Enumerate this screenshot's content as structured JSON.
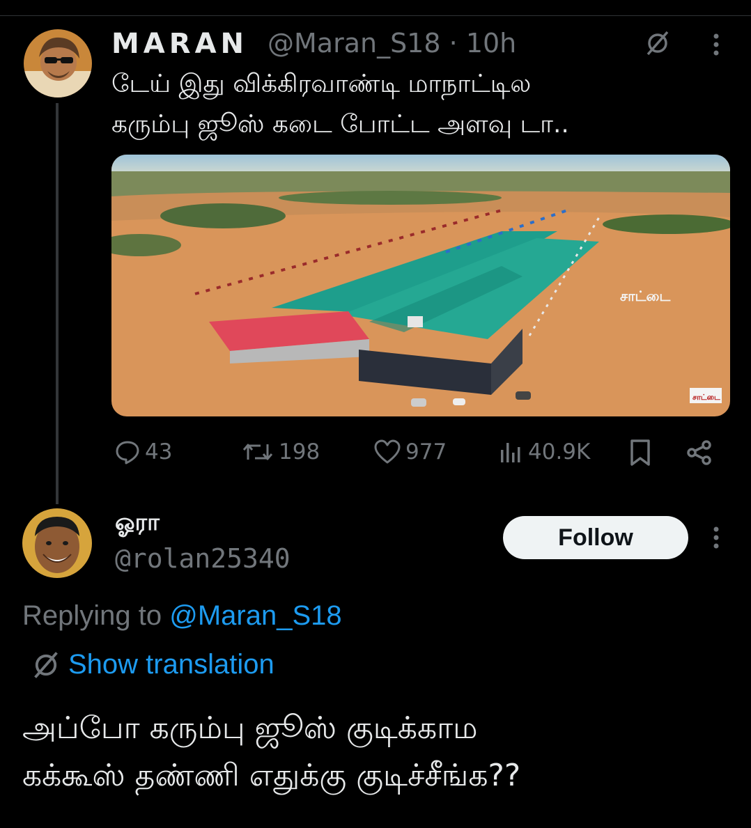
{
  "colors": {
    "background": "#000000",
    "text": "#e7e9ea",
    "muted": "#71767b",
    "link": "#1d9bf0",
    "button": "#eff3f4"
  },
  "tweet": {
    "author_name": "MARAN",
    "handle": "@Maran_S18",
    "separator": "·",
    "time": "10h",
    "text_line1": "டேய் இது விக்கிரவாண்டி மாநாட்டில",
    "text_line2": "கரும்பு ஜூஸ் கடை போட்ட அளவு டா..",
    "media_description_icon": "aerial-venue-photo",
    "actions": {
      "replies": "43",
      "retweets": "198",
      "likes": "977",
      "views": "40.9K"
    }
  },
  "reply": {
    "author_name": "ஓரா",
    "handle": "@rolan25340",
    "follow_label": "Follow",
    "replying_prefix": "Replying to",
    "replying_mention": "@Maran_S18",
    "translate_label": "Show translation",
    "text_line1": "அப்போ கரும்பு ஜூஸ் குடிக்காம",
    "text_line2": "கக்கூஸ் தண்ணி எதுக்கு குடிச்சீங்க??"
  }
}
